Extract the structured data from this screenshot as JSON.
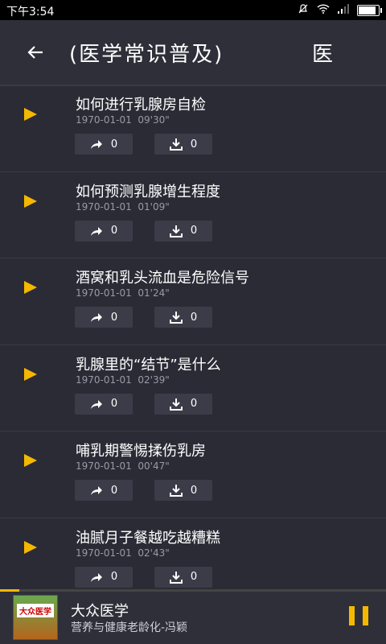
{
  "status": {
    "time": "下午3:54"
  },
  "appbar": {
    "title": "(医学常识普及)",
    "right_text": "医"
  },
  "items": [
    {
      "title": "如何进行乳腺房自检",
      "date": "1970-01-01",
      "duration": "09'30\"",
      "shares": "0",
      "downloads": "0"
    },
    {
      "title": "如何预测乳腺增生程度",
      "date": "1970-01-01",
      "duration": "01'09\"",
      "shares": "0",
      "downloads": "0"
    },
    {
      "title": "酒窝和乳头流血是危险信号",
      "date": "1970-01-01",
      "duration": "01'24\"",
      "shares": "0",
      "downloads": "0"
    },
    {
      "title": "乳腺里的“结节”是什么",
      "date": "1970-01-01",
      "duration": "02'39\"",
      "shares": "0",
      "downloads": "0"
    },
    {
      "title": "哺乳期警惕揉伤乳房",
      "date": "1970-01-01",
      "duration": "00'47\"",
      "shares": "0",
      "downloads": "0"
    },
    {
      "title": "油腻月子餐越吃越糟糕",
      "date": "1970-01-01",
      "duration": "02'43\"",
      "shares": "0",
      "downloads": "0"
    }
  ],
  "player": {
    "title": "大众医学",
    "subtitle": "营养与健康老龄化-冯颖",
    "cover_label": "大众医学",
    "progress": 0.05
  },
  "colors": {
    "accent": "#f5b800",
    "background": "#2b2b36"
  }
}
